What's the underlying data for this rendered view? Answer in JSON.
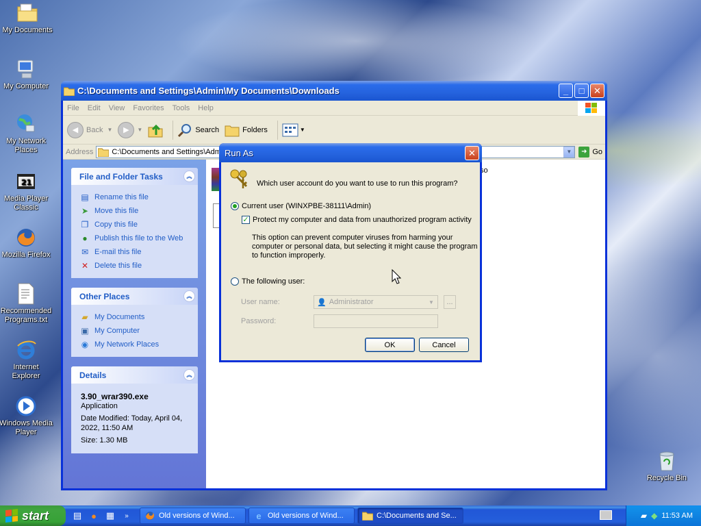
{
  "desktop": {
    "icons": [
      {
        "label": "My Documents"
      },
      {
        "label": "My Computer"
      },
      {
        "label": "My Network Places"
      },
      {
        "label": "Media Player Classic"
      },
      {
        "label": "Mozilla Firefox"
      },
      {
        "label": "Recommended Programs.txt"
      },
      {
        "label": "Internet Explorer"
      },
      {
        "label": "Windows Media Player"
      },
      {
        "label": "Recycle Bin"
      }
    ]
  },
  "explorer": {
    "title": "C:\\Documents and Settings\\Admin\\My Documents\\Downloads",
    "menu": [
      "File",
      "Edit",
      "View",
      "Favorites",
      "Tools",
      "Help"
    ],
    "toolbar": {
      "back": "Back",
      "search": "Search",
      "folders": "Folders"
    },
    "address": {
      "label": "Address",
      "value": "C:\\Documents and Settings\\Admin",
      "go": "Go"
    },
    "file_tasks": {
      "heading": "File and Folder Tasks",
      "items": [
        "Rename this file",
        "Move this file",
        "Copy this file",
        "Publish this file to the Web",
        "E-mail this file",
        "Delete this file"
      ]
    },
    "other_places": {
      "heading": "Other Places",
      "items": [
        "My Documents",
        "My Computer",
        "My Network Places"
      ]
    },
    "details": {
      "heading": "Details",
      "name": "3.90_wrar390.exe",
      "type": "Application",
      "modified": "Date Modified: Today, April 04, 2022, 11:50 AM",
      "size": "Size: 1.30 MB"
    },
    "partial_text": "so"
  },
  "run_as": {
    "title": "Run As",
    "question": "Which user account do you want to use to run this program?",
    "current_user": "Current user (WINXPBE-38111\\Admin)",
    "protect": "Protect my computer and data from unauthorized program activity",
    "explain": "This option can prevent computer viruses from harming your computer or personal data, but selecting it might cause the program to function improperly.",
    "following_user": "The following user:",
    "username_label": "User name:",
    "username_value": "Administrator",
    "password_label": "Password:",
    "ok": "OK",
    "cancel": "Cancel",
    "browse": "..."
  },
  "taskbar": {
    "start": "start",
    "tasks": [
      "Old versions of Wind...",
      "Old versions of Wind...",
      "C:\\Documents and Se..."
    ],
    "clock": "11:53 AM"
  }
}
